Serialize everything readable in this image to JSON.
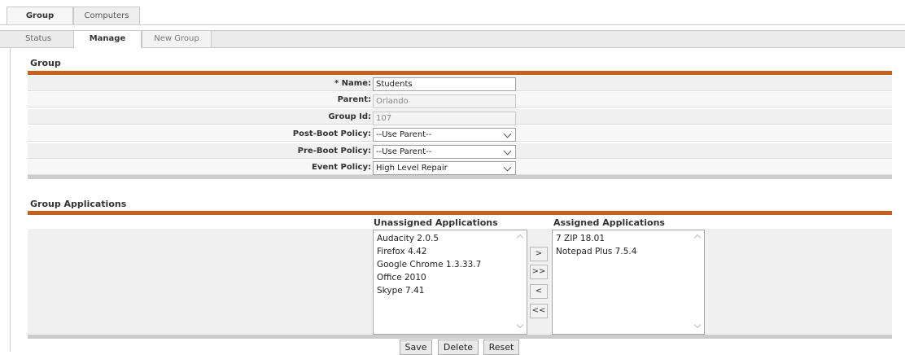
{
  "top_tabs": [
    "Group",
    "Computers"
  ],
  "sub_tabs": [
    "Status",
    "Manage",
    "New Group"
  ],
  "group_section": {
    "title": "Group",
    "fields": {
      "name": {
        "label": "* Name:",
        "value": "Students"
      },
      "parent": {
        "label": "Parent:",
        "value": "Orlando"
      },
      "group_id": {
        "label": "Group Id:",
        "value": "107"
      },
      "post_boot": {
        "label": "Post-Boot Policy:",
        "value": "--Use Parent--"
      },
      "pre_boot": {
        "label": "Pre-Boot Policy:",
        "value": "--Use Parent--"
      },
      "event": {
        "label": "Event Policy:",
        "value": "High Level Repair"
      }
    }
  },
  "apps_section": {
    "title": "Group Applications",
    "unassigned_header": "Unassigned Applications",
    "assigned_header": "Assigned Applications",
    "unassigned": [
      "Audacity 2.0.5",
      "Firefox 4.42",
      "Google Chrome 1.3.33.7",
      "Office 2010",
      "Skype 7.41"
    ],
    "assigned": [
      "7 ZIP 18.01",
      "Notepad Plus 7.5.4"
    ],
    "move_buttons": [
      ">",
      ">>",
      "<",
      "<<"
    ]
  },
  "actions": {
    "save": "Save",
    "delete": "Delete",
    "reset": "Reset"
  },
  "colors": {
    "accent": "#c5611e"
  }
}
